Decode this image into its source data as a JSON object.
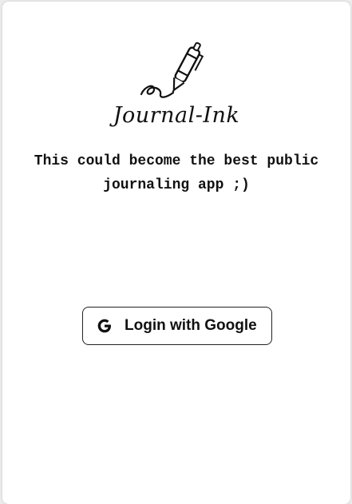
{
  "app": {
    "brand_name": "Journal-Ink",
    "tagline": "This could become the best public journaling app ;)",
    "logo_icon": "pen-writing-icon"
  },
  "login": {
    "button_label": "Login with Google",
    "button_icon": "google-icon"
  },
  "colors": {
    "text": "#111111",
    "background": "#ffffff",
    "border": "#222222"
  }
}
